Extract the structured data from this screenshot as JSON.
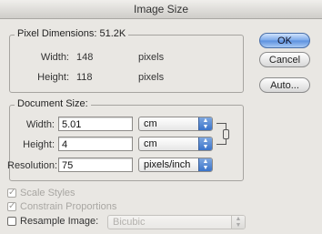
{
  "window": {
    "title": "Image Size"
  },
  "pixel_dimensions": {
    "title": "Pixel Dimensions:",
    "size": "51.2K",
    "width_label": "Width:",
    "width_value": "148",
    "width_unit": "pixels",
    "height_label": "Height:",
    "height_value": "118",
    "height_unit": "pixels"
  },
  "buttons": {
    "ok": "OK",
    "cancel": "Cancel",
    "auto": "Auto..."
  },
  "document_size": {
    "title": "Document Size:",
    "width_label": "Width:",
    "width_value": "5.01",
    "width_unit": "cm",
    "height_label": "Height:",
    "height_value": "4",
    "height_unit": "cm",
    "resolution_label": "Resolution:",
    "resolution_value": "75",
    "resolution_unit": "pixels/inch"
  },
  "options": {
    "scale_styles": {
      "label": "Scale Styles",
      "checked": true,
      "enabled": false
    },
    "constrain_proportions": {
      "label": "Constrain Proportions",
      "checked": true,
      "enabled": false
    },
    "resample_image": {
      "label": "Resample Image:",
      "checked": false,
      "enabled": true
    },
    "resample_method": "Bicubic"
  },
  "icons": {
    "select_arrow": "up-down-arrows",
    "checkmark": "check",
    "link": "chain-link"
  }
}
